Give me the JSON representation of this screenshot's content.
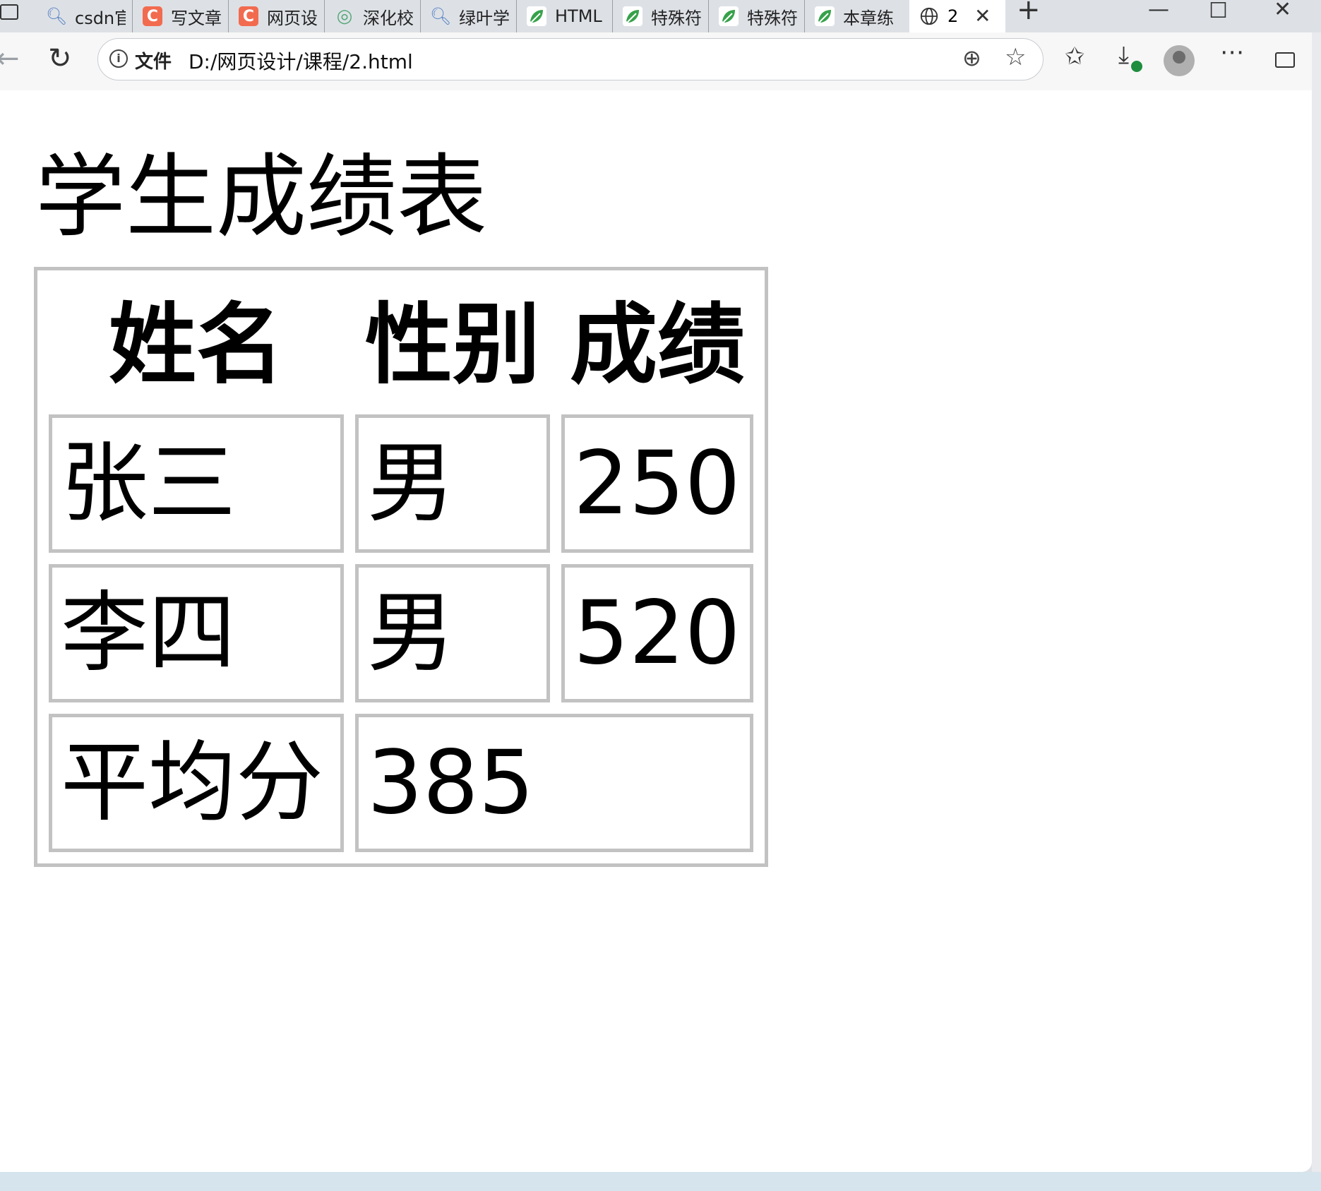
{
  "tabs": [
    {
      "label": "csdn官",
      "favicon": "search-icon"
    },
    {
      "label": "写文章",
      "favicon": "csdn-icon"
    },
    {
      "label": "网页设",
      "favicon": "csdn-icon"
    },
    {
      "label": "深化校",
      "favicon": "circle-icon"
    },
    {
      "label": "绿叶学",
      "favicon": "search-icon"
    },
    {
      "label": "HTML",
      "favicon": "leaf-icon"
    },
    {
      "label": "特殊符",
      "favicon": "leaf-icon"
    },
    {
      "label": "特殊符",
      "favicon": "leaf-icon"
    },
    {
      "label": "本章练",
      "favicon": "leaf-icon"
    }
  ],
  "active_tab": {
    "label": "2",
    "favicon": "globe-icon"
  },
  "favicon_glyphs": {
    "csdn": "C"
  },
  "address_bar": {
    "security_label": "文件",
    "url": "D:/网页设计/课程/2.html"
  },
  "page": {
    "heading": "学生成绩表",
    "table": {
      "headers": [
        "姓名",
        "性别",
        "成绩"
      ],
      "rows": [
        [
          "张三",
          "男",
          "250"
        ],
        [
          "李四",
          "男",
          "520"
        ]
      ],
      "average": {
        "label": "平均分",
        "value": "385"
      }
    }
  },
  "colors": {
    "table_border": "#c2c2c2",
    "chrome_background": "#dde1e6",
    "download_badge": "#1e8e3e"
  }
}
